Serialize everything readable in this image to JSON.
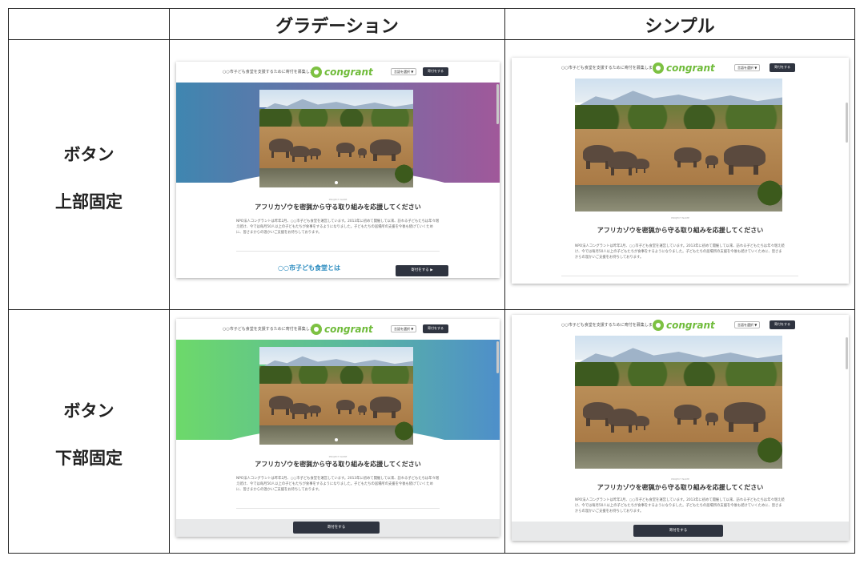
{
  "table": {
    "col_headers": [
      "グラデーション",
      "シンプル"
    ],
    "row_labels": [
      {
        "line1": "ボタン",
        "line2": "上部固定"
      },
      {
        "line1": "ボタン",
        "line2": "下部固定"
      }
    ]
  },
  "mock": {
    "nav_text": "○○市子ども食堂を支援するために寄付を募集します",
    "logo_text": "congrant",
    "lang_label": "言語を選択 ▼",
    "donate_small": "寄付をする",
    "tagline": "PROJECT NAME",
    "title": "アフリカゾウを密猟から守る取り組みを応援してください",
    "paragraph": "NPO法人コングラントは昨年2月、○○市子ども食堂を運営しています。2013年に初めて開催して以来、訪れる子どもたちは年々増え続け、今では毎月50人以上の子どもたちが食事をするようになりました。子どもたちの居場所の支援を今後も続けていくために、皆さまからの温かいご支援をお待ちしております。",
    "link_text": "○○市子ども食堂とは",
    "donate_large": "寄付をする",
    "donate_large_alt": "寄付をする ▶"
  },
  "colors": {
    "gradient_top": [
      "#3f86b0",
      "#a0589a"
    ],
    "gradient_bottom": [
      "#6dd96a",
      "#4e8fca"
    ],
    "brand_green": "#6fbb3a",
    "button_dark": "#2f3440",
    "link_blue": "#2a8bbf"
  }
}
